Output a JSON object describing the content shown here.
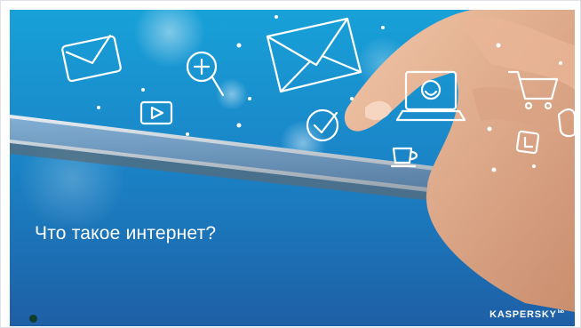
{
  "slide": {
    "title": "Что такое интернет?",
    "brand": "KASPERSKY",
    "brand_suffix": "lab",
    "colors": {
      "background_top": "#18a1d8",
      "background_bottom": "#1e5fa6",
      "text": "#ffffff",
      "indicator": "#0f3d2e"
    },
    "icons": [
      "mail-icon",
      "envelope-icon",
      "magnifier-plus-icon",
      "video-play-icon",
      "checkmark-icon",
      "laptop-smiley-icon",
      "shopping-cart-icon",
      "coffee-cup-icon",
      "badge-icon",
      "chat-bubble-icon"
    ]
  }
}
